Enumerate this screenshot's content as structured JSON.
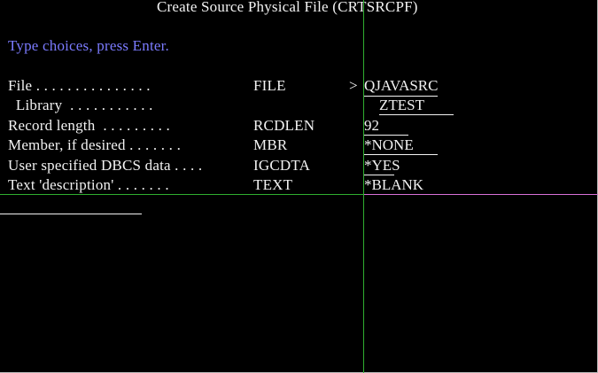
{
  "screen": {
    "title": "Create Source Physical File (CRTSRCPF)",
    "instruction": "Type choices, press Enter."
  },
  "rows": [
    {
      "label": "File . . . . . . . . . . . . . . .",
      "keyword": "FILE",
      "prompt": ">",
      "value": "QJAVASRC"
    },
    {
      "label": "  Library  . . . . . . . . . . .",
      "keyword": "",
      "prompt": "",
      "value": "ZTEST"
    },
    {
      "label": "Record length  . . . . . . . . .",
      "keyword": "RCDLEN",
      "prompt": "",
      "value": "92"
    },
    {
      "label": "Member, if desired . . . . . . .",
      "keyword": "MBR",
      "prompt": "",
      "value": "*NONE"
    },
    {
      "label": "User specified DBCS data . . . .",
      "keyword": "IGCDTA",
      "prompt": "",
      "value": "*YES"
    },
    {
      "label": "Text 'description' . . . . . . .",
      "keyword": "TEXT",
      "prompt": "",
      "value": "*BLANK"
    }
  ],
  "colors": {
    "background": "#000000",
    "text": "#f2f2f2",
    "instruction": "#7b7bff",
    "column_line": "#2fae2f",
    "row_line": "#d870d8"
  }
}
